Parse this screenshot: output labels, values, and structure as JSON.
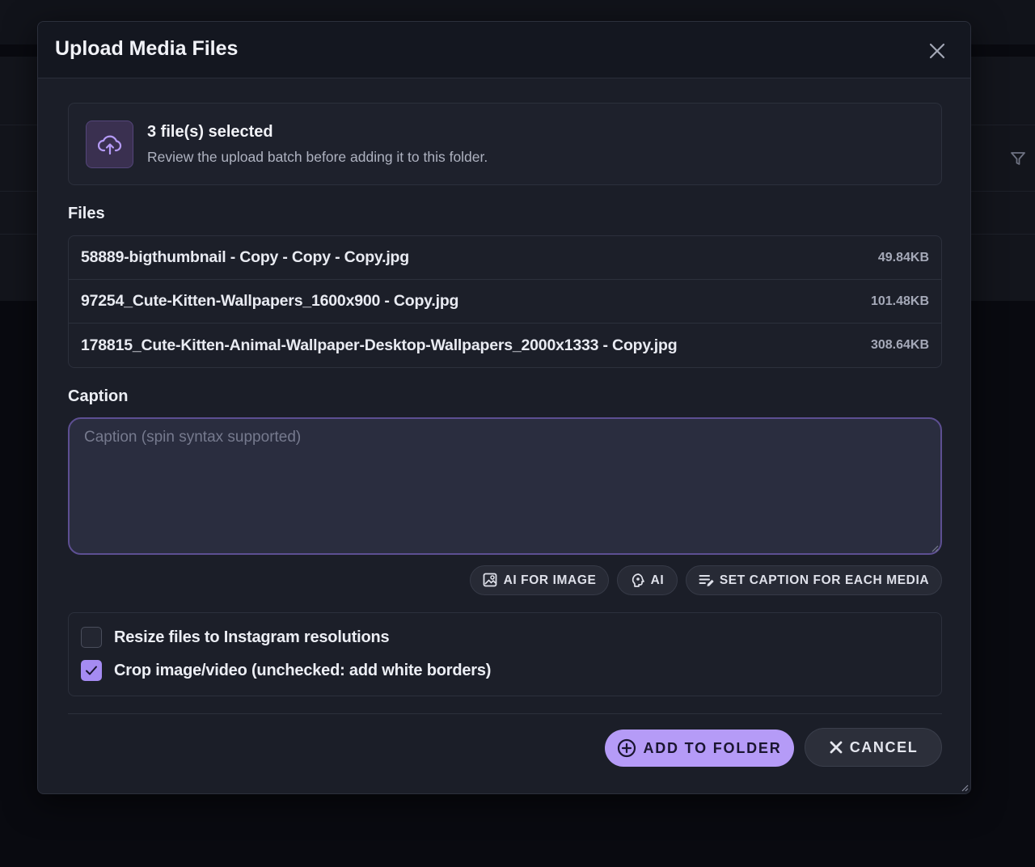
{
  "dialog": {
    "title": "Upload Media Files",
    "close_icon": "close-icon"
  },
  "summary": {
    "icon": "cloud-upload-icon",
    "title": "3 file(s) selected",
    "subtitle": "Review the upload batch before adding it to this folder."
  },
  "files": {
    "label": "Files",
    "items": [
      {
        "name": "58889-bigthumbnail - Copy - Copy - Copy.jpg",
        "size": "49.84KB"
      },
      {
        "name": "97254_Cute-Kitten-Wallpapers_1600x900 - Copy.jpg",
        "size": "101.48KB"
      },
      {
        "name": "178815_Cute-Kitten-Animal-Wallpaper-Desktop-Wallpapers_2000x1333 - Copy.jpg",
        "size": "308.64KB"
      }
    ]
  },
  "caption": {
    "label": "Caption",
    "value": "",
    "placeholder": "Caption (spin syntax supported)"
  },
  "caption_tools": {
    "ai_for_image": "AI FOR IMAGE",
    "ai": "AI",
    "set_caption_each": "SET CAPTION FOR EACH MEDIA"
  },
  "options": {
    "resize": {
      "label": "Resize files to Instagram resolutions",
      "checked": false
    },
    "crop": {
      "label": "Crop image/video (unchecked: add white borders)",
      "checked": true
    }
  },
  "actions": {
    "add_to_folder": "ADD TO FOLDER",
    "cancel": "CANCEL"
  },
  "colors": {
    "accent": "#b59bf7",
    "checkbox_checked": "#a58bf2",
    "modal_bg": "#1b1e28"
  }
}
